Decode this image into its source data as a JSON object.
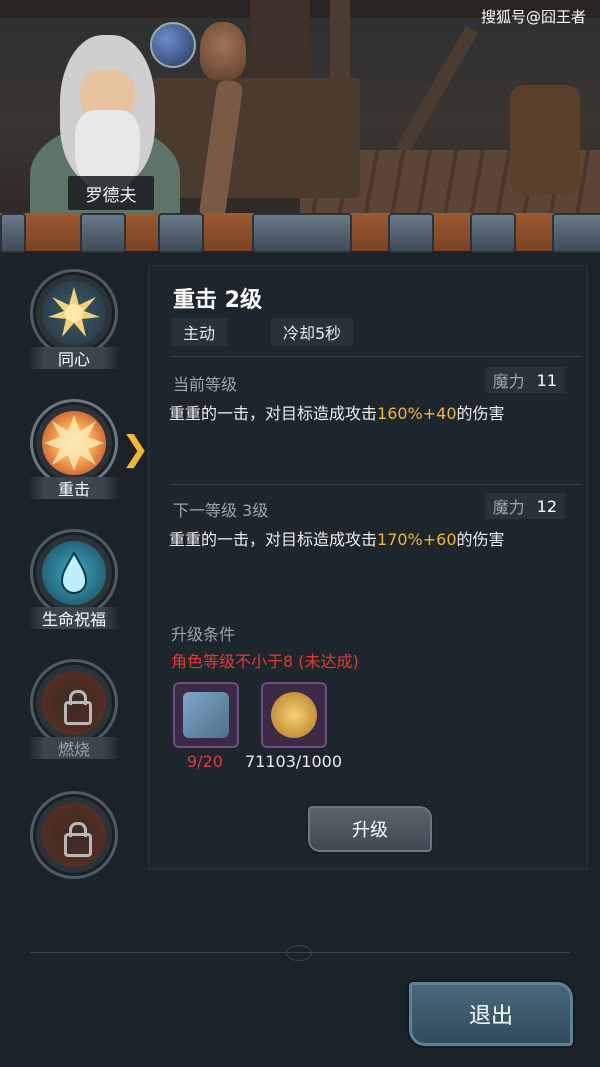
{
  "watermark": "搜狐号@囧王者",
  "character": {
    "name": "罗德夫"
  },
  "skills": [
    {
      "label": "同心",
      "locked": false,
      "icon": "sun-icon"
    },
    {
      "label": "重击",
      "locked": false,
      "selected": true,
      "icon": "burst-icon"
    },
    {
      "label": "生命祝福",
      "locked": false,
      "icon": "droplet-icon"
    },
    {
      "label": "燃烧",
      "locked": true,
      "icon": "lock-icon"
    },
    {
      "label": "",
      "locked": true,
      "icon": "lock-icon"
    }
  ],
  "detail": {
    "title": "重击 2级",
    "tag_type": "主动",
    "tag_cooldown": "冷却5秒",
    "current": {
      "label": "当前等级",
      "mana_label": "魔力",
      "mana_value": "11",
      "desc_prefix": "重重的一击，对目标造成攻击",
      "desc_value": "160%+40",
      "desc_suffix": "的伤害"
    },
    "next": {
      "label": "下一等级 3级",
      "mana_label": "魔力",
      "mana_value": "12",
      "desc_prefix": "重重的一击，对目标造成攻击",
      "desc_value": "170%+60",
      "desc_suffix": "的伤害"
    },
    "requirement": {
      "title": "升级条件",
      "text": "角色等级不小于8 (未达成)"
    },
    "materials": [
      {
        "icon": "map-scroll-icon",
        "count": "9/20",
        "insufficient": true
      },
      {
        "icon": "gold-coin-icon",
        "count": "71103/1000",
        "insufficient": false
      }
    ],
    "upgrade_button": "升级"
  },
  "exit_button": "退出",
  "colors": {
    "highlight": "#f0b642",
    "warning": "#e03a32",
    "panel": "#1e262d"
  }
}
